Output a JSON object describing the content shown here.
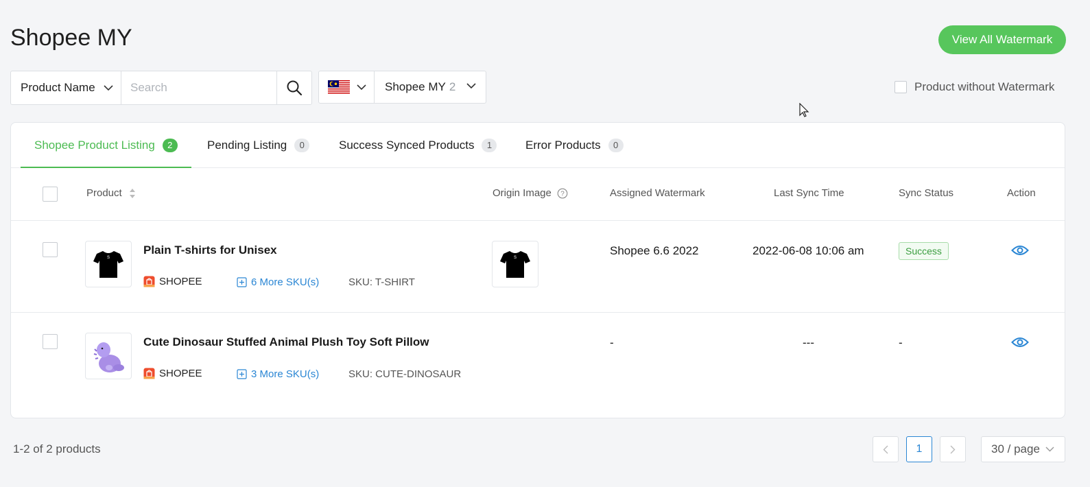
{
  "header": {
    "title": "Shopee MY",
    "view_all_label": "View All Watermark"
  },
  "filters": {
    "field_select": "Product Name",
    "search_placeholder": "Search",
    "search_value": "",
    "country_icon": "malaysia-flag-icon",
    "store_select": "Shopee MY",
    "store_count": "2",
    "without_watermark_label": "Product without Watermark"
  },
  "tabs": [
    {
      "label": "Shopee Product Listing",
      "count": "2",
      "active": true
    },
    {
      "label": "Pending Listing",
      "count": "0"
    },
    {
      "label": "Success Synced Products",
      "count": "1"
    },
    {
      "label": "Error Products",
      "count": "0"
    }
  ],
  "table": {
    "columns": {
      "product": "Product",
      "origin_image": "Origin Image",
      "assigned_watermark": "Assigned Watermark",
      "last_sync_time": "Last Sync Time",
      "sync_status": "Sync Status",
      "action": "Action"
    },
    "rows": [
      {
        "name": "Plain T-shirts for Unisex",
        "platform": "SHOPEE",
        "more_skus": "6 More SKU(s)",
        "sku": "SKU: T-SHIRT",
        "watermark": "Shopee 6.6 2022",
        "last_sync": "2022-06-08 10:06 am",
        "status": "Success",
        "thumb_icon": "tshirt-icon",
        "thumb_letter": "S"
      },
      {
        "name": "Cute Dinosaur Stuffed Animal Plush Toy Soft Pillow",
        "platform": "SHOPEE",
        "more_skus": "3 More SKU(s)",
        "sku": "SKU: CUTE-DINOSAUR",
        "watermark": "-",
        "last_sync": "---",
        "status": "-",
        "thumb_icon": "dinosaur-plush-icon"
      }
    ]
  },
  "pagination": {
    "summary": "1-2 of 2 products",
    "current_page": "1",
    "per_page": "30 / page"
  },
  "colors": {
    "accent": "#57c65c",
    "link": "#2a86d4",
    "platform": "#ee4d2d"
  }
}
